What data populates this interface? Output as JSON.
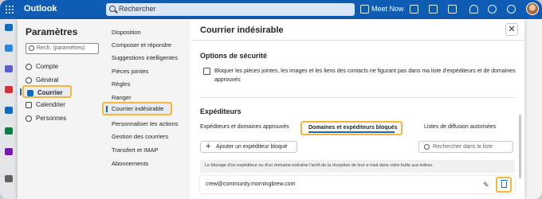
{
  "app": {
    "title": "Outlook"
  },
  "topbar": {
    "search_placeholder": "Rechercher",
    "meet_now": "Meet Now"
  },
  "settings": {
    "title": "Paramètres",
    "search_placeholder": "Rech. (paramètres)",
    "nav": [
      {
        "label": "Compte",
        "icon": "person-icon"
      },
      {
        "label": "Général",
        "icon": "gear-icon"
      },
      {
        "label": "Courrier",
        "icon": "mail-icon",
        "active": true
      },
      {
        "label": "Calendrier",
        "icon": "calendar-icon"
      },
      {
        "label": "Personnes",
        "icon": "people-icon"
      }
    ],
    "subnav": [
      "Disposition",
      "Composer et répondre",
      "Suggestions intelligentes",
      "Pièces jointes",
      "Règles",
      "Ranger",
      "Courrier indésirable",
      "Personnaliser les actions",
      "Gestion des courriers",
      "Transfert et IMAP",
      "Abonnements"
    ]
  },
  "pane": {
    "title": "Courrier indésirable",
    "close_label": "✕",
    "security": {
      "heading": "Options de sécurité",
      "checkbox_label": "Bloquer les pièces jointes, les images et les liens des contacts ne figurant pas dans ma liste d'expéditeurs et de domaines approuvés"
    },
    "senders": {
      "heading": "Expéditeurs",
      "tabs": [
        "Expéditeurs et domaines approuvés",
        "Domaines et expéditeurs bloqués",
        "Listes de diffusion autorisées"
      ],
      "add_button": "Ajouter un expéditeur bloqué",
      "search_placeholder": "Rechercher dans la liste",
      "info": "Le blocage d'un expéditeur ou d'un domaine entraîne l'arrêt de la réception de leur e-mail dans votre boîte aux lettres.",
      "blocked": [
        "crew@community.morningbrew.com"
      ]
    }
  },
  "colors": {
    "brand": "#0f5cb5",
    "highlight": "#f7b53b",
    "accent": "#0f6cbd"
  }
}
